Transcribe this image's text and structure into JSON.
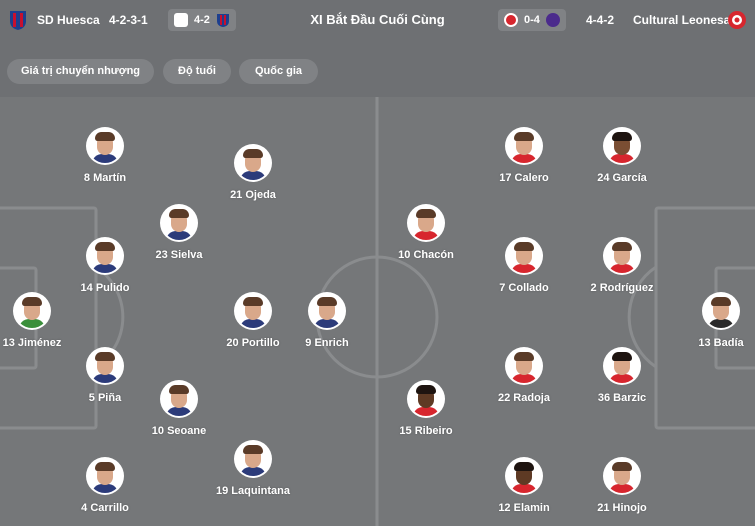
{
  "header": {
    "home_team": "SD Huesca",
    "home_formation": "4-2-3-1",
    "home_score_label": "4-2",
    "title": "XI Bắt Đầu Cuối Cùng",
    "away_score_label": "0-4",
    "away_formation": "4-4-2",
    "away_team": "Cultural Leonesa",
    "home_crest_icon": "sd-huesca-crest-icon",
    "away_crest_icon": "cultural-leonesa-crest-icon"
  },
  "filters": {
    "market_value": "Giá trị chuyển nhượng",
    "age": "Độ tuổi",
    "nationality": "Quốc gia"
  },
  "home_players": [
    {
      "label": "8 Martín"
    },
    {
      "label": "21 Ojeda"
    },
    {
      "label": "23 Sielva"
    },
    {
      "label": "14 Pulido"
    },
    {
      "label": "13 Jiménez"
    },
    {
      "label": "20 Portillo"
    },
    {
      "label": "9 Enrich"
    },
    {
      "label": "5 Piña"
    },
    {
      "label": "10 Seoane"
    },
    {
      "label": "19 Laquintana"
    },
    {
      "label": "4 Carrillo"
    }
  ],
  "away_players": [
    {
      "label": "17 Calero"
    },
    {
      "label": "24 García"
    },
    {
      "label": "10 Chacón"
    },
    {
      "label": "7 Collado"
    },
    {
      "label": "2 Rodríguez"
    },
    {
      "label": "13 Badía"
    },
    {
      "label": "22 Radoja"
    },
    {
      "label": "36 Barzic"
    },
    {
      "label": "15 Ribeiro"
    },
    {
      "label": "12 Elamin"
    },
    {
      "label": "21 Hinojo"
    }
  ],
  "colors": {
    "background": "#6e7073",
    "pitch": "#757779",
    "line": "#8a8c8e",
    "chip": "#808285",
    "huesca_blue": "#1d3f8f",
    "huesca_red": "#c8102e",
    "cultural_red": "#d7262e"
  }
}
